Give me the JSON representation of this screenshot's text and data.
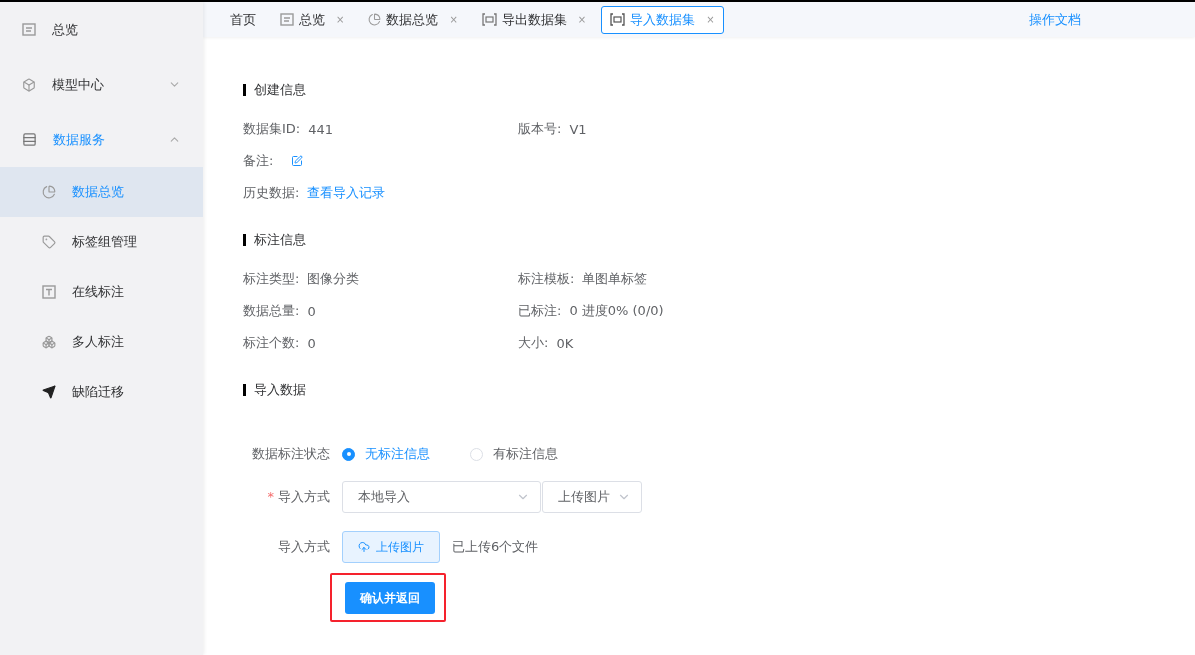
{
  "sidebar": {
    "items": [
      {
        "label": "总览",
        "selected": false
      },
      {
        "label": "模型中心",
        "selected": false,
        "expanded": false
      },
      {
        "label": "数据服务",
        "selected": true,
        "expanded": true,
        "children": [
          {
            "label": "数据总览",
            "selected": true
          },
          {
            "label": "标签组管理",
            "selected": false
          },
          {
            "label": "在线标注",
            "selected": false
          },
          {
            "label": "多人标注",
            "selected": false
          },
          {
            "label": "缺陷迁移",
            "selected": false
          }
        ]
      }
    ]
  },
  "tabs": [
    {
      "label": "首页",
      "selected": false
    },
    {
      "label": "总览",
      "selected": false,
      "close": "×"
    },
    {
      "label": "数据总览",
      "selected": false,
      "close": "×"
    },
    {
      "label": "导出数据集",
      "selected": false,
      "close": "×"
    },
    {
      "label": "导入数据集",
      "selected": true,
      "close": "×"
    }
  ],
  "doc_link": "操作文档",
  "sections": [
    {
      "title": "创建信息",
      "rows": [
        [
          {
            "kind": "text",
            "label": "数据集ID:",
            "value": "441"
          },
          {
            "kind": "text",
            "label": "版本号:",
            "value": "V1"
          }
        ],
        [
          {
            "kind": "edit",
            "label": "备注:"
          }
        ],
        [
          {
            "kind": "link",
            "label": "历史数据:",
            "value": "查看导入记录"
          }
        ]
      ]
    },
    {
      "title": "标注信息",
      "rows": [
        [
          {
            "kind": "text",
            "label": "标注类型:",
            "value": "图像分类"
          },
          {
            "kind": "text",
            "label": "标注模板:",
            "value": "单图单标签"
          }
        ],
        [
          {
            "kind": "text",
            "label": "数据总量:",
            "value": "0"
          },
          {
            "kind": "text",
            "label": "已标注:",
            "value": "0 进度0% (0/0)"
          }
        ],
        [
          {
            "kind": "text",
            "label": "标注个数:",
            "value": "0"
          },
          {
            "kind": "text",
            "label": "大小:",
            "value": "0K"
          }
        ]
      ]
    },
    {
      "title": "导入数据"
    }
  ],
  "import_form": {
    "status": {
      "label": "数据标注状态",
      "options": [
        {
          "label": "无标注信息",
          "selected": true
        },
        {
          "label": "有标注信息",
          "selected": false
        }
      ]
    },
    "method": {
      "label": "导入方式",
      "required_mark": "*",
      "selects": [
        {
          "value": "本地导入"
        },
        {
          "value": "上传图片"
        }
      ]
    },
    "upload": {
      "label": "导入方式",
      "button": "上传图片",
      "note": "已上传6个文件"
    },
    "submit": {
      "label": "确认并返回",
      "highlighted": true
    }
  }
}
